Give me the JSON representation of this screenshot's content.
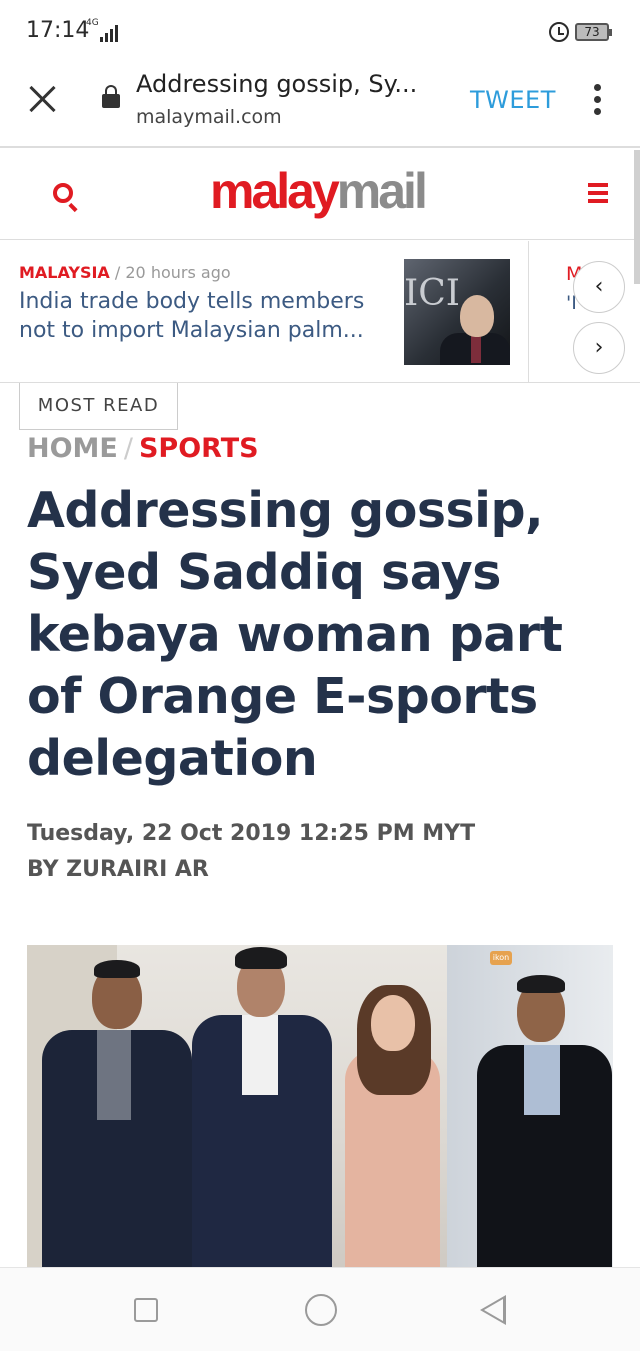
{
  "status_bar": {
    "time": "17:14",
    "network": "4G",
    "battery": "73"
  },
  "browser": {
    "page_title": "Addressing gossip, Sy...",
    "url": "malaymail.com",
    "tweet_label": "TWEET"
  },
  "site": {
    "logo_part1": "malay",
    "logo_part2": "mail",
    "accent_color": "#e01b22"
  },
  "ticker": {
    "category": "MALAYSIA",
    "time_ago": "/ 20 hours ago",
    "title": "India trade body tells members not to import Malaysian palm...",
    "image_text": "ICI",
    "next_category_initial": "M",
    "next_title_initial": "'I S",
    "prev_icon": "‹",
    "next_icon": "›"
  },
  "most_read_label": "MOST READ",
  "breadcrumb": {
    "home": "HOME",
    "separator": "/",
    "section": "SPORTS"
  },
  "article": {
    "headline": "Addressing gossip, Syed Saddiq says kebaya woman part of Orange E-sports delegation",
    "date": "Tuesday, 22 Oct 2019 12:25 PM MYT",
    "byline": "BY ZURAIRI AR",
    "photo_logo": "ikon"
  }
}
